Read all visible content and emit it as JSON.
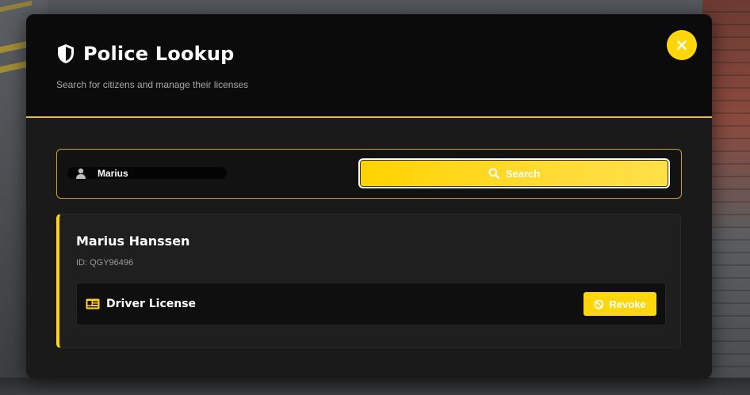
{
  "header": {
    "title": "Police Lookup",
    "subtitle": "Search for citizens and manage their licenses",
    "close_icon": "close-icon"
  },
  "search": {
    "value": "Marius",
    "button_label": "Search",
    "input_icon": "person-icon",
    "button_icon": "search-icon"
  },
  "result": {
    "name": "Marius Hanssen",
    "id_label": "ID: QGY96496",
    "licenses": [
      {
        "label": "Driver License",
        "icon": "id-card-icon",
        "action_label": "Revoke",
        "action_icon": "ban-icon"
      }
    ]
  },
  "colors": {
    "accent": "#ffd60a",
    "panel": "#1a1a1a",
    "header": "#0b0b0b"
  }
}
